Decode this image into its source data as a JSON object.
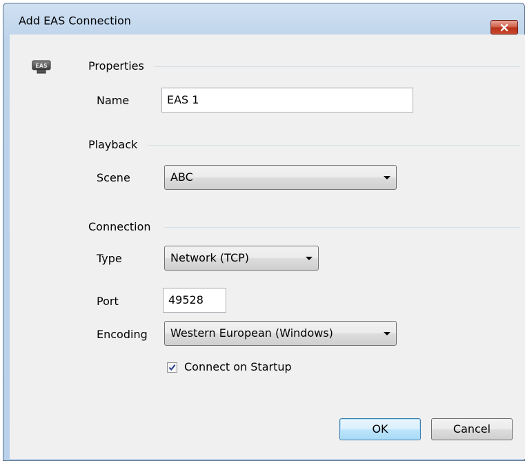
{
  "window": {
    "title": "Add EAS Connection",
    "close_icon": "close-icon",
    "app_icon": "eas-icon",
    "app_icon_text": "EAS"
  },
  "properties": {
    "heading": "Properties",
    "name_label": "Name",
    "name_value": "EAS 1"
  },
  "playback": {
    "heading": "Playback",
    "scene_label": "Scene",
    "scene_value": "ABC"
  },
  "connection": {
    "heading": "Connection",
    "type_label": "Type",
    "type_value": "Network (TCP)",
    "port_label": "Port",
    "port_value": "49528",
    "encoding_label": "Encoding",
    "encoding_value": "Western European (Windows)",
    "startup_label": "Connect on Startup",
    "startup_checked": true
  },
  "buttons": {
    "ok": "OK",
    "cancel": "Cancel"
  },
  "colors": {
    "titlebar": "#bcd3ea",
    "close_button": "#c74a2f",
    "dialog_bg": "#f0f0f0",
    "default_button_border": "#3c7fb1"
  }
}
